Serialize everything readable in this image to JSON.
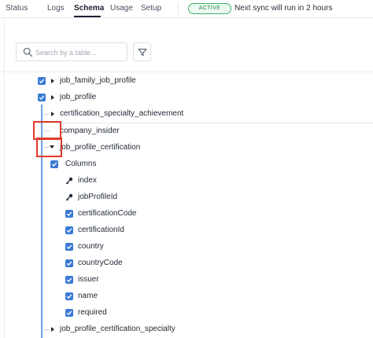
{
  "tabs": [
    {
      "label": "Status",
      "active": false
    },
    {
      "label": "Logs",
      "active": false
    },
    {
      "label": "Schema",
      "active": true
    },
    {
      "label": "Usage",
      "active": false
    },
    {
      "label": "Setup",
      "active": false
    }
  ],
  "status_badge": "ACTIVE",
  "sync_text": "Next sync will run in 2 hours",
  "search": {
    "placeholder": "Search by a table..."
  },
  "tree": {
    "job_family_job_profile": "job_family_job_profile",
    "job_profile": "job_profile",
    "certification_specialty_achievement": "certification_specialty_achievement",
    "company_insider": "company_insider",
    "job_profile_certification": "job_profile_certification",
    "columns_label": "Columns",
    "columns": {
      "index": "index",
      "jobProfileId": "jobProfileId",
      "certificationCode": "certificationCode",
      "certificationId": "certificationId",
      "country": "country",
      "countryCode": "countryCode",
      "issuer": "issuer",
      "name": "name",
      "required": "required"
    },
    "job_profile_certification_specialty": "job_profile_certification_specialty"
  },
  "colors": {
    "accent": "#3a7bd5",
    "active_green": "#3db06a",
    "highlight_red": "#e2392b",
    "tree_line": "#6da1e0"
  }
}
